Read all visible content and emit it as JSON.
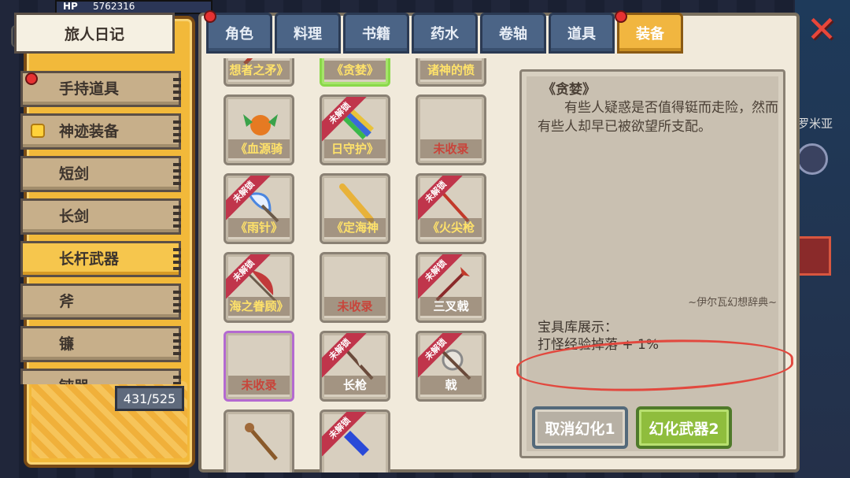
{
  "hud": {
    "hp_label": "HP",
    "hp_value": "5762316",
    "map_label": "罗米亚"
  },
  "journal": {
    "title": "旅人日记",
    "categories": [
      {
        "label": "手持道具"
      },
      {
        "label": "神迹装备"
      },
      {
        "label": "短剑"
      },
      {
        "label": "长剑"
      },
      {
        "label": "长杆武器"
      },
      {
        "label": "斧"
      },
      {
        "label": "镰"
      },
      {
        "label": "钝器"
      }
    ],
    "count": "431/525"
  },
  "tabs": [
    "角色",
    "料理",
    "书籍",
    "药水",
    "卷轴",
    "道具",
    "装备"
  ],
  "grid": {
    "items": [
      {
        "name": "想者之矛》",
        "locked": false
      },
      {
        "name": "《贪婪》",
        "locked": false
      },
      {
        "name": "诸神的愤",
        "locked": false
      },
      {
        "name": "《血源骑",
        "locked": false
      },
      {
        "name": "日守护》",
        "locked": true
      },
      {
        "name": "未收录",
        "locked": false
      },
      {
        "name": "《雨针》",
        "locked": true
      },
      {
        "name": "《定海神",
        "locked": false
      },
      {
        "name": "《火尖枪",
        "locked": true
      },
      {
        "name": "海之眷顾》",
        "locked": true
      },
      {
        "name": "未收录",
        "locked": false
      },
      {
        "name": "三叉戟",
        "locked": true
      },
      {
        "name": "未收录",
        "locked": false
      },
      {
        "name": "长枪",
        "locked": true
      },
      {
        "name": "戟",
        "locked": true
      },
      {
        "name": "",
        "locked": false
      },
      {
        "name": "",
        "locked": true
      }
    ],
    "locked_label": "未解锁"
  },
  "detail": {
    "title": "《贪婪》",
    "text": "有些人疑惑是否值得铤而走险，然而有些人却早已被欲望所支配。",
    "source": "~伊尔瓦幻想辞典~",
    "bonus_title": "宝具库展示：",
    "bonus": "打怪经验掉落 + 1%"
  },
  "buttons": {
    "cancel": "取消幻化1",
    "confirm": "幻化武器2"
  },
  "close": "✕"
}
